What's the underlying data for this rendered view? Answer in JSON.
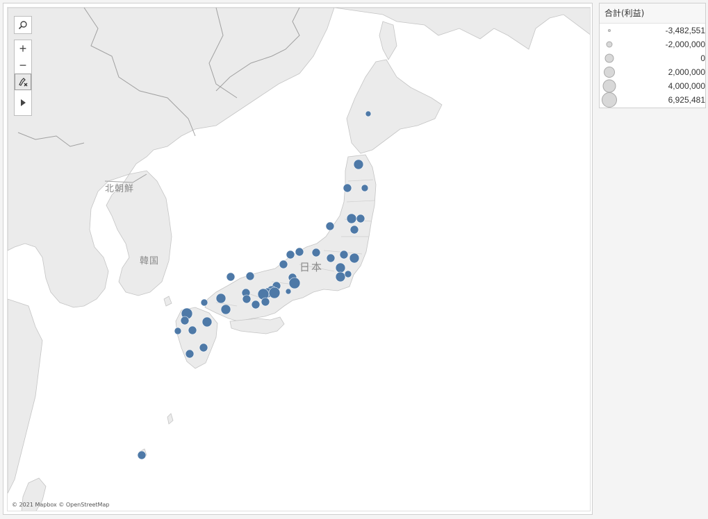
{
  "map": {
    "labels": {
      "north_korea": "北朝鮮",
      "south_korea": "韓国",
      "japan": "日本"
    },
    "attribution": "© 2021 Mapbox © OpenStreetMap",
    "marker_color": "#4e79a7",
    "controls": {
      "search": "search-icon",
      "zoom_in": "+",
      "zoom_out": "−",
      "pan_select": "pin-icon",
      "expand": "play-icon"
    }
  },
  "legend": {
    "title": "合計(利益)",
    "items": [
      {
        "label": "-3,482,551",
        "size": 3
      },
      {
        "label": "-2,000,000",
        "size": 8
      },
      {
        "label": "0",
        "size": 12
      },
      {
        "label": "2,000,000",
        "size": 15
      },
      {
        "label": "4,000,000",
        "size": 18
      },
      {
        "label": "6,925,481",
        "size": 22
      }
    ]
  }
}
